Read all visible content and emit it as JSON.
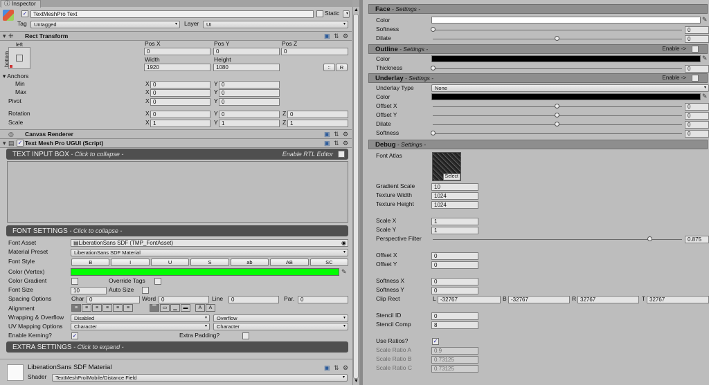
{
  "tab": {
    "label": "Inspector"
  },
  "object": {
    "name": "TextMeshPro Text",
    "static_label": "Static",
    "tag_label": "Tag",
    "tag_value": "Untagged",
    "layer_label": "Layer",
    "layer_value": "UI"
  },
  "rect": {
    "title": "Rect Transform",
    "anchor_h": "left",
    "anchor_v": "bottom",
    "pos_x_label": "Pos X",
    "pos_y_label": "Pos Y",
    "pos_z_label": "Pos Z",
    "pos_x": "0",
    "pos_y": "0",
    "pos_z": "0",
    "width_label": "Width",
    "height_label": "Height",
    "width": "1920",
    "height": "1080",
    "btn_r": "R",
    "anchors_label": "Anchors",
    "min_label": "Min",
    "max_label": "Max",
    "pivot_label": "Pivot",
    "rotation_label": "Rotation",
    "scale_label": "Scale",
    "x": "X",
    "y": "Y",
    "z": "Z",
    "min_x": "0",
    "min_y": "0",
    "max_x": "0",
    "max_y": "0",
    "pivot_x": "0",
    "pivot_y": "0",
    "rot_x": "0",
    "rot_y": "0",
    "rot_z": "0",
    "scale_x": "1",
    "scale_y": "1",
    "scale_z": "1"
  },
  "canvas_renderer": {
    "title": "Canvas Renderer"
  },
  "tmp": {
    "title": "Text Mesh Pro UGUI (Script)",
    "input_box": "TEXT INPUT BOX",
    "collapse": " - Click to collapse -",
    "rtl_label": "Enable RTL Editor",
    "font_settings": "FONT SETTINGS",
    "extra_settings": "EXTRA SETTINGS",
    "expand": " - Click to expand -"
  },
  "font": {
    "font_asset_label": "Font Asset",
    "font_asset": "LiberationSans SDF (TMP_FontAsset)",
    "material_preset_label": "Material Preset",
    "material_preset": "LiberationSans SDF Material",
    "font_style_label": "Font Style",
    "styles": [
      "B",
      "I",
      "U",
      "S",
      "ab",
      "AB",
      "SC"
    ],
    "color_label": "Color (Vertex)",
    "color_gradient_label": "Color Gradient",
    "override_tags_label": "Override Tags",
    "font_size_label": "Font Size",
    "font_size": "10",
    "auto_size_label": "Auto Size",
    "spacing_label": "Spacing Options",
    "char_label": "Char",
    "char": "0",
    "word_label": "Word",
    "word": "0",
    "line_label": "Line",
    "line": "0",
    "par_label": "Par.",
    "par": "0",
    "alignment_label": "Alignment",
    "wrapping_label": "Wrapping & Overflow",
    "wrapping": "Disabled",
    "overflow": "Overflow",
    "uv_label": "UV Mapping Options",
    "uv_h": "Character",
    "uv_v": "Character",
    "kerning_label": "Enable Kerning?",
    "extra_padding_label": "Extra Padding?",
    "vertex_color": "#00ff00"
  },
  "material": {
    "name": "LiberationSans SDF Material",
    "shader_label": "Shader",
    "shader": "TextMeshPro/Mobile/Distance Field"
  },
  "face": {
    "title": "Face",
    "settings": " - Settings -",
    "color_label": "Color",
    "softness_label": "Softness",
    "softness": "0",
    "dilate_label": "Dilate",
    "dilate": "0",
    "color": "#ffffff"
  },
  "outline": {
    "title": "Outline",
    "settings": " - Settings -",
    "enable": "Enable ->",
    "color_label": "Color",
    "thickness_label": "Thickness",
    "thickness": "0",
    "color": "#000000"
  },
  "underlay": {
    "title": "Underlay",
    "settings": " - Settings -",
    "enable": "Enable ->",
    "type_label": "Underlay Type",
    "type": "None",
    "color_label": "Color",
    "offset_x_label": "Offset X",
    "offset_x": "0",
    "offset_y_label": "Offset Y",
    "offset_y": "0",
    "dilate_label": "Dilate",
    "dilate": "0",
    "softness_label": "Softness",
    "softness": "0",
    "color": "#000000"
  },
  "debug": {
    "title": "Debug",
    "settings": " - Settings -",
    "font_atlas_label": "Font Atlas",
    "select": "Select",
    "gradient_scale_label": "Gradient Scale",
    "gradient_scale": "10",
    "texture_width_label": "Texture Width",
    "texture_width": "1024",
    "texture_height_label": "Texture Height",
    "texture_height": "1024",
    "scale_x_label": "Scale X",
    "scale_x": "1",
    "scale_y_label": "Scale Y",
    "scale_y": "1",
    "perspective_label": "Perspective Filter",
    "perspective": "0.875",
    "offset_x_label": "Offset X",
    "offset_x": "0",
    "offset_y_label": "Offset Y",
    "offset_y": "0",
    "softness_x_label": "Softness X",
    "softness_x": "0",
    "softness_y_label": "Softness Y",
    "softness_y": "0",
    "clip_rect_label": "Clip Rect",
    "clip_l_label": "L",
    "clip_l": "-32767",
    "clip_b_label": "B",
    "clip_b": "-32767",
    "clip_r_label": "R",
    "clip_r": "32767",
    "clip_t_label": "T",
    "clip_t": "32767",
    "stencil_id_label": "Stencil ID",
    "stencil_id": "0",
    "stencil_comp_label": "Stencil Comp",
    "stencil_comp": "8",
    "use_ratios_label": "Use Ratios?",
    "ratio_a_label": "Scale Ratio A",
    "ratio_a": "0.9",
    "ratio_b_label": "Scale Ratio B",
    "ratio_b": "0.73125",
    "ratio_c_label": "Scale Ratio C",
    "ratio_c": "0.73125"
  }
}
